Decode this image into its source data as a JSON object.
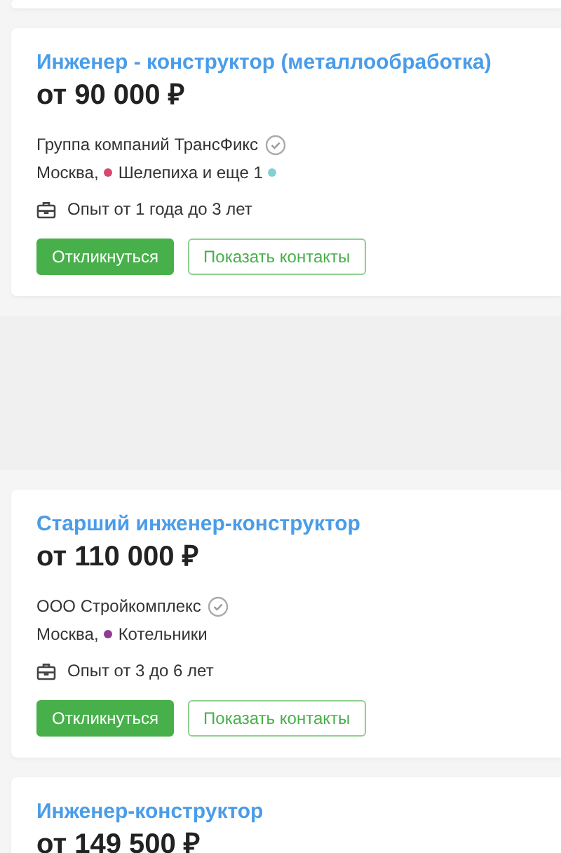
{
  "vacancies": [
    {
      "kind": "full",
      "title": "Инженер - конструктор (металлообработка)",
      "salary": "от 90 000 ₽",
      "company": "Группа компаний ТрансФикс",
      "verified": true,
      "city": "Москва,",
      "station": {
        "text": "Шелепиха и еще 1",
        "color": "#d9476b"
      },
      "more": {
        "color": "#82d0d2"
      },
      "experience": "Опыт от 1 года до 3 лет",
      "buttons": [
        "Откликнуться",
        "Показать контакты"
      ]
    },
    {
      "kind": "empty"
    },
    {
      "kind": "full",
      "title": "Старший инженер-конструктор",
      "salary": "от 110 000 ₽",
      "company": "ООО Стройкомплекс",
      "verified": true,
      "city": "Москва,",
      "station": {
        "text": "Котельники",
        "color": "#8e3b96"
      },
      "experience": "Опыт от 3 до 6 лет",
      "buttons": [
        "Откликнуться",
        "Показать контакты"
      ]
    },
    {
      "kind": "cut",
      "title": "Инженер-конструктор",
      "salary": "от 149 500 ₽"
    }
  ]
}
